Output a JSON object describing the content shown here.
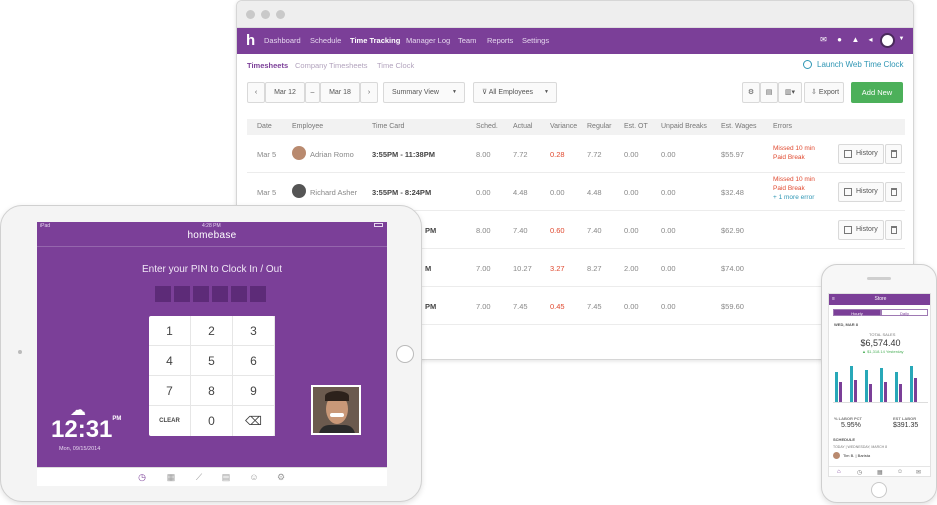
{
  "browser": {
    "logo": "h",
    "nav": [
      "Dashboard",
      "Schedule",
      "Time Tracking",
      "Manager Log",
      "Team",
      "Reports",
      "Settings"
    ],
    "subtabs": [
      "Timesheets",
      "Company Timesheets",
      "Time Clock"
    ],
    "launch": "Launch Web Time Clock",
    "date_from": "Mar 12",
    "date_to": "Mar 18",
    "date_sep": "–",
    "view": "Summary View",
    "employees": "All Employees",
    "export": "Export",
    "add_new": "Add New",
    "columns": [
      "Date",
      "Employee",
      "Time Card",
      "Sched.",
      "Actual",
      "Variance",
      "Regular",
      "Est. OT",
      "Unpaid Breaks",
      "Est. Wages",
      "Errors"
    ],
    "rows": [
      {
        "date": "Mar 5",
        "employee": "Adrian Romo",
        "card": "3:55PM - 11:38PM",
        "sched": "8.00",
        "actual": "7.72",
        "variance": "0.28",
        "regular": "7.72",
        "ot": "0.00",
        "breaks": "0.00",
        "wages": "$55.97",
        "err1": "Missed 10 min",
        "err2": "Paid Break",
        "err3": ""
      },
      {
        "date": "Mar 5",
        "employee": "Richard Asher",
        "card": "3:55PM - 8:24PM",
        "sched": "0.00",
        "actual": "4.48",
        "variance": "0.00",
        "regular": "4.48",
        "ot": "0.00",
        "breaks": "0.00",
        "wages": "$32.48",
        "err1": "Missed 10 min",
        "err2": "Paid Break",
        "err3": "+ 1 more error"
      },
      {
        "date": "",
        "employee": "",
        "card": "PM",
        "sched": "8.00",
        "actual": "7.40",
        "variance": "0.60",
        "regular": "7.40",
        "ot": "0.00",
        "breaks": "0.00",
        "wages": "$62.90",
        "err1": "",
        "err2": "",
        "err3": ""
      },
      {
        "date": "",
        "employee": "",
        "card": "M",
        "sched": "7.00",
        "actual": "10.27",
        "variance": "3.27",
        "regular": "8.27",
        "ot": "2.00",
        "breaks": "0.00",
        "wages": "$74.00",
        "err1": "",
        "err2": "",
        "err3": ""
      },
      {
        "date": "",
        "employee": "",
        "card": "PM",
        "sched": "7.00",
        "actual": "7.45",
        "variance": "0.45",
        "regular": "7.45",
        "ot": "0.00",
        "breaks": "0.00",
        "wages": "$59.60",
        "err1": "",
        "err2": "",
        "err3": ""
      }
    ],
    "history": "History"
  },
  "tablet": {
    "status_left": "iPad",
    "status_time": "4:28 PM",
    "brand": "homebase",
    "pin_prompt": "Enter your PIN to Clock In / Out",
    "keys": [
      "1",
      "2",
      "3",
      "4",
      "5",
      "6",
      "7",
      "8",
      "9",
      "CLEAR",
      "0",
      "⌫"
    ],
    "time": "12:31",
    "time_suffix": "PM",
    "date": "Mon, 09/15/2014"
  },
  "phone": {
    "title": "Store",
    "tabs": [
      "Hourly",
      "Daily"
    ],
    "date_label": "WED, MAR 8",
    "total_label": "TOTAL SALES",
    "total": "$6,574.40",
    "total_sub": "▲ $1,318.14 Yesterday",
    "stat1_label": "% LABOR PCT",
    "stat1_value": "5.95%",
    "stat2_label": "EST LABOR",
    "stat2_value": "$391.35",
    "schedule_label": "SCHEDULE",
    "today_label": "TODAY | WEDNESDAY, MARCH 8",
    "shift_name": "Tim B. | Barista",
    "colors": {
      "bar_teal": "#28a8b8",
      "bar_purple": "#7b3f98"
    }
  },
  "colors": {
    "brand": "#7b3f98",
    "green": "#4cb05a",
    "error": "#e0492f",
    "link": "#2f96b4"
  }
}
